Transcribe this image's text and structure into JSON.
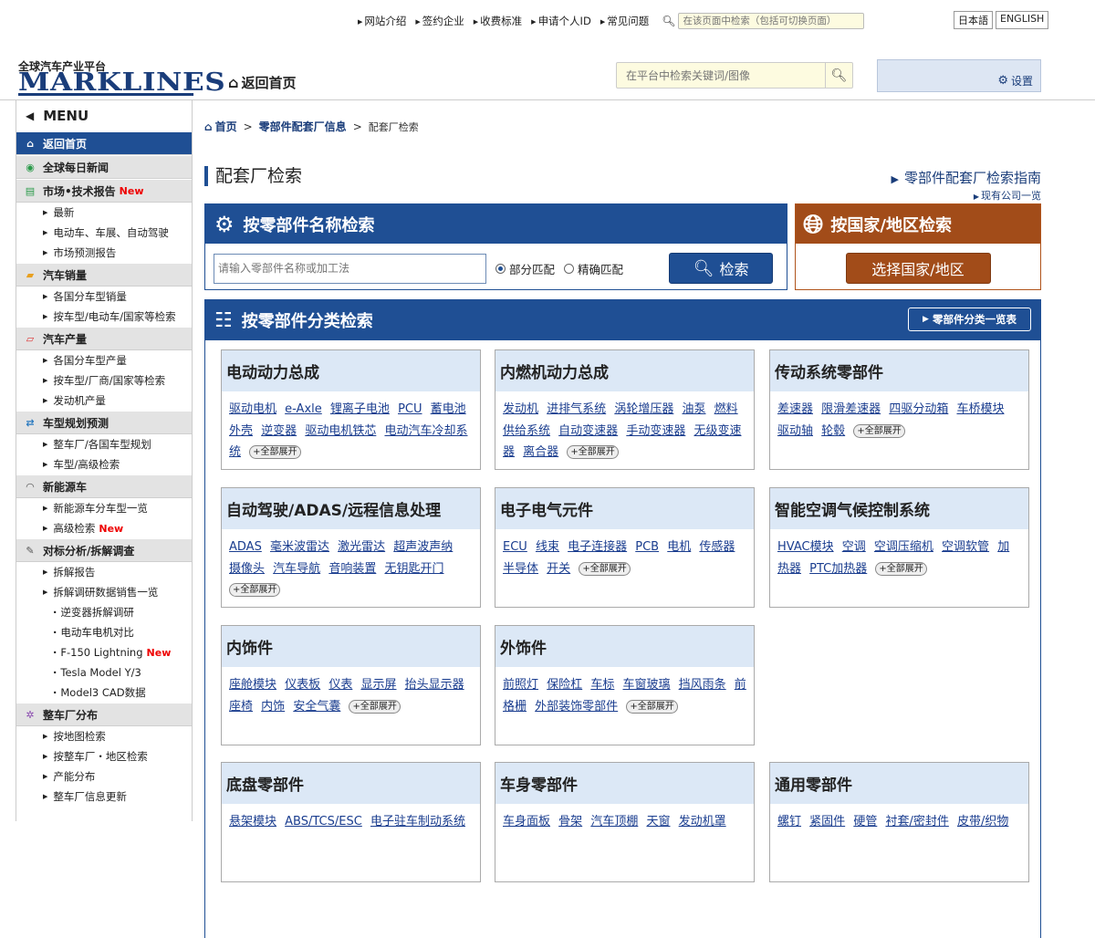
{
  "topnav": {
    "links": [
      "网站介绍",
      "签约企业",
      "收费标准",
      "申请个人ID",
      "常见问题"
    ],
    "search_placeholder": "在该页面中检索（包括可切换页面）"
  },
  "languages": [
    "日本語",
    "ENGLISH"
  ],
  "logo": {
    "tagline": "全球汽车产业平台",
    "brand": "MARKLINES"
  },
  "header": {
    "home_label": "返回首页",
    "search_placeholder": "在平台中检索关键词/图像",
    "settings_label": "设置"
  },
  "sidebar": {
    "menu_label": "MENU",
    "new_label": "New",
    "s_home": "返回首页",
    "s_news": "全球每日新闻",
    "s_reports": "市场•技术报告",
    "i_latest": "最新",
    "i_ev_show": "电动车、车展、自动驾驶",
    "i_forecast": "市场预测报告",
    "s_sales": "汽车销量",
    "i_sales_country": "各国分车型销量",
    "i_sales_search": "按车型/电动车/国家等检索",
    "s_production": "汽车产量",
    "i_prod_country": "各国分车型产量",
    "i_prod_search": "按车型/厂商/国家等检索",
    "i_engine_prod": "发动机产量",
    "s_plan": "车型规划预测",
    "i_plan_oem": "整车厂/各国车型规划",
    "i_plan_search": "车型/高级检索",
    "s_nev": "新能源车",
    "i_nev_list": "新能源车分车型一览",
    "i_nev_adv": "高级检索",
    "s_teardown": "对标分析/拆解调查",
    "i_td_report": "拆解报告",
    "i_td_list": "拆解调研数据销售一览",
    "sub_inverter": "逆变器拆解调研",
    "sub_motor": "电动车电机对比",
    "sub_f150": "F-150 Lightning",
    "sub_tesla": "Tesla Model Y/3",
    "sub_model3": "Model3 CAD数据",
    "s_plants": "整车厂分布",
    "i_map": "按地图检索",
    "i_oem_region": "按整车厂・地区检索",
    "i_capacity": "产能分布",
    "i_more": "整车厂信息更新"
  },
  "breadcrumb": {
    "home": "首页",
    "parts": "零部件配套厂信息",
    "current": "配套厂检索"
  },
  "page": {
    "title": "配套厂检索",
    "guide": "零部件配套厂检索指南",
    "company_list": "现有公司一览"
  },
  "part_search": {
    "title": "按零部件名称检索",
    "placeholder": "请输入零部件名称或加工法",
    "partial": "部分匹配",
    "exact": "精确匹配",
    "button": "检索"
  },
  "country_search": {
    "title": "按国家/地区检索",
    "button": "选择国家/地区"
  },
  "category": {
    "title": "按零部件分类检索",
    "list_button": "零部件分类一览表",
    "expand_label": "+全部展开",
    "cards": [
      {
        "title": "电动动力总成",
        "links": [
          "驱动电机",
          "e-Axle",
          "锂离子电池",
          "PCU",
          "蓄电池外壳",
          "逆变器",
          "驱动电机铁芯",
          "电动汽车冷却系统"
        ]
      },
      {
        "title": "内燃机动力总成",
        "links": [
          "发动机",
          "进排气系统",
          "涡轮增压器",
          "油泵",
          "燃料供给系统",
          "自动变速器",
          "手动变速器",
          "无级变速器",
          "离合器"
        ]
      },
      {
        "title": "传动系统零部件",
        "links": [
          "差速器",
          "限滑差速器",
          "四驱分动箱",
          "车桥模块",
          "驱动轴",
          "轮毂"
        ]
      },
      {
        "title": "自动驾驶/ADAS/远程信息处理",
        "links": [
          "ADAS",
          "毫米波雷达",
          "激光雷达",
          "超声波声纳",
          "摄像头",
          "汽车导航",
          "音响装置",
          "无钥匙开门"
        ]
      },
      {
        "title": "电子电气元件",
        "links": [
          "ECU",
          "线束",
          "电子连接器",
          "PCB",
          "电机",
          "传感器",
          "半导体",
          "开关"
        ]
      },
      {
        "title": "智能空调气候控制系统",
        "links": [
          "HVAC模块",
          "空调",
          "空调压缩机",
          "空调软管",
          "加热器",
          "PTC加热器"
        ]
      },
      {
        "title": "内饰件",
        "links": [
          "座舱模块",
          "仪表板",
          "仪表",
          "显示屏",
          "抬头显示器",
          "座椅",
          "内饰",
          "安全气囊"
        ]
      },
      {
        "title": "外饰件",
        "links": [
          "前照灯",
          "保险杠",
          "车标",
          "车窗玻璃",
          "挡风雨条",
          "前格栅",
          "外部装饰零部件"
        ]
      },
      {
        "title": "底盘零部件",
        "links": [
          "悬架模块",
          "ABS/TCS/ESC",
          "电子驻车制动系统"
        ]
      },
      {
        "title": "车身零部件",
        "links": [
          "车身面板",
          "骨架",
          "汽车顶棚",
          "天窗",
          "发动机罩"
        ]
      },
      {
        "title": "通用零部件",
        "links": [
          "螺钉",
          "紧固件",
          "硬管",
          "衬套/密封件",
          "皮带/织物"
        ]
      }
    ]
  }
}
